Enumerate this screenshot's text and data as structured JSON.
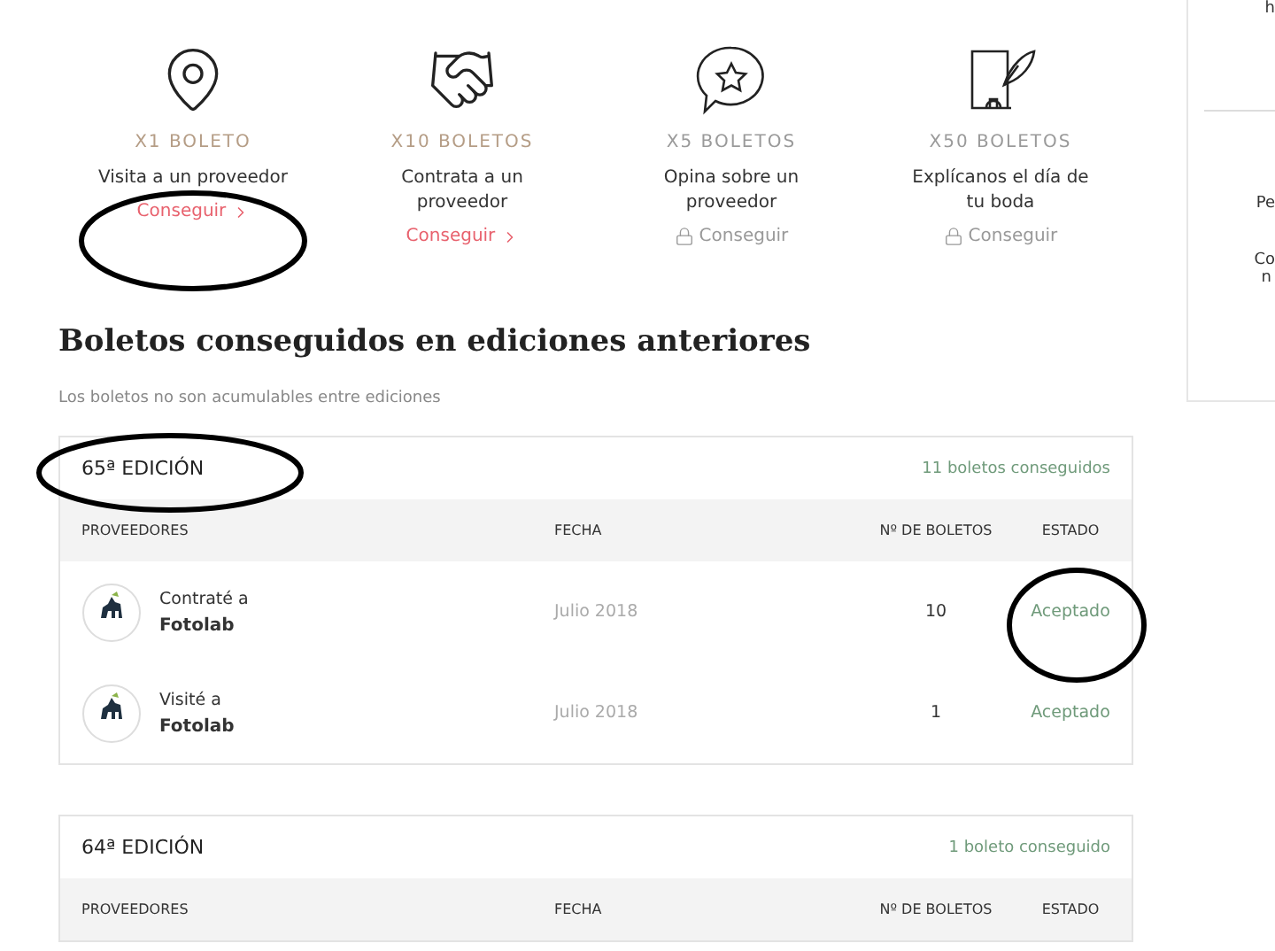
{
  "features": [
    {
      "kind": "pin",
      "tickets": "X1 BOLETO",
      "text": "Visita a un proveedor",
      "link": "Conseguir",
      "locked": false
    },
    {
      "kind": "handshake",
      "tickets": "X10 BOLETOS",
      "text": "Contrata a un proveedor",
      "link": "Conseguir",
      "locked": false
    },
    {
      "kind": "review",
      "tickets": "X5 BOLETOS",
      "text": "Opina sobre un proveedor",
      "link": "Conseguir",
      "locked": true
    },
    {
      "kind": "story",
      "tickets": "X50 BOLETOS",
      "text": "Explícanos el día de tu boda",
      "link": "Conseguir",
      "locked": true
    }
  ],
  "section": {
    "title": "Boletos conseguidos en ediciones anteriores",
    "subtitle": "Los boletos no son acumulables entre ediciones"
  },
  "editions": [
    {
      "title": "65ª EDICIÓN",
      "count": "11 boletos conseguidos",
      "columns": [
        "PROVEEDORES",
        "FECHA",
        "Nº DE BOLETOS",
        "ESTADO"
      ],
      "rows": [
        {
          "action": "Contraté a",
          "provider": "Fotolab",
          "date": "Julio 2018",
          "tickets": "10",
          "status": "Aceptado"
        },
        {
          "action": "Visité a",
          "provider": "Fotolab",
          "date": "Julio 2018",
          "tickets": "1",
          "status": "Aceptado"
        }
      ]
    },
    {
      "title": "64ª EDICIÓN",
      "count": "1 boleto conseguido",
      "columns": [
        "PROVEEDORES",
        "FECHA",
        "Nº DE BOLETOS",
        "ESTADO"
      ]
    }
  ],
  "sidebar": {
    "texts": [
      "h",
      "Pe",
      "Co",
      "n"
    ]
  }
}
